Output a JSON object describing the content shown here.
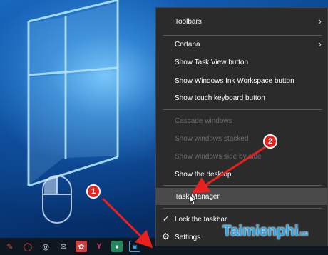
{
  "menu": {
    "items": [
      {
        "label": "Toolbars",
        "submenu": true
      },
      {
        "label": "Cortana",
        "submenu": true
      },
      {
        "label": "Show Task View button"
      },
      {
        "label": "Show Windows Ink Workspace button"
      },
      {
        "label": "Show touch keyboard button"
      },
      {
        "label": "Cascade windows",
        "disabled": true
      },
      {
        "label": "Show windows stacked",
        "disabled": true
      },
      {
        "label": "Show windows side by side",
        "disabled": true
      },
      {
        "label": "Show the desktop"
      },
      {
        "label": "Task Manager",
        "highlighted": true
      },
      {
        "label": "Lock the taskbar",
        "checked": true
      },
      {
        "label": "Settings",
        "icon": "gear-icon"
      }
    ]
  },
  "callouts": {
    "step1": "1",
    "step2": "2"
  },
  "watermark": {
    "brand": "Taimienphi",
    "suffix": ".vn"
  },
  "taskbar": {
    "icons": [
      "pin-icon",
      "app-icon",
      "wifi-icon",
      "mail-icon",
      "paint-icon",
      "flag-icon",
      "video-icon",
      "window-icon"
    ]
  },
  "colors": {
    "menu_bg": "#2b2b2b",
    "highlight": "#4a4a4a",
    "callout": "#e8201e",
    "watermark": "#26a4e6"
  }
}
